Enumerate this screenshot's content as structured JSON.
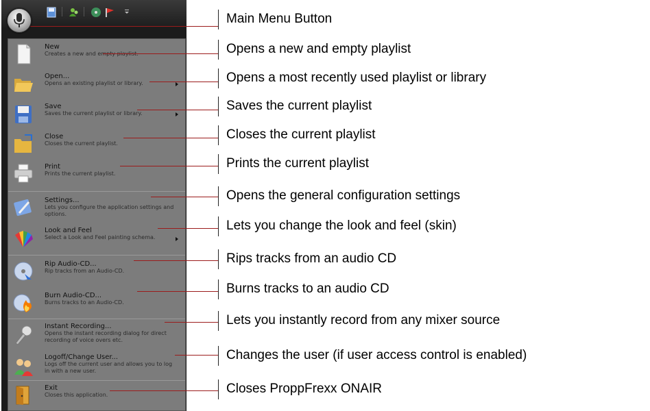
{
  "menu": {
    "items": [
      {
        "title": "New",
        "desc": "Creates a new and empty playlist.",
        "icon": "new-document-icon"
      },
      {
        "title": "Open...",
        "desc": "Opens an existing playlist or library.",
        "icon": "open-folder-icon"
      },
      {
        "title": "Save",
        "desc": "Saves the current playlist or library.",
        "icon": "save-floppy-icon"
      },
      {
        "title": "Close",
        "desc": "Closes the current playlist.",
        "icon": "close-folder-icon"
      },
      {
        "title": "Print",
        "desc": "Prints the current playlist.",
        "icon": "printer-icon"
      },
      {
        "title": "Settings...",
        "desc": "Lets you configure the application settings and options.",
        "icon": "settings-icon"
      },
      {
        "title": "Look and Feel",
        "desc": "Select a Look and Feel painting schema.",
        "icon": "palette-icon"
      },
      {
        "title": "Rip Audio-CD...",
        "desc": "Rip tracks from an Audio-CD.",
        "icon": "rip-cd-icon"
      },
      {
        "title": "Burn Audio-CD...",
        "desc": "Burns tracks to an Audio-CD.",
        "icon": "burn-cd-icon"
      },
      {
        "title": "Instant Recording...",
        "desc": "Opens the instant recording dialog for direct recording of voice overs etc.",
        "icon": "microphone-icon"
      },
      {
        "title": "Logoff/Change User...",
        "desc": "Logs off the current user and allows you to log in with a new user.",
        "icon": "users-icon"
      },
      {
        "title": "Exit",
        "desc": "Closes this application.",
        "icon": "exit-door-icon"
      }
    ]
  },
  "callouts": [
    "Main Menu Button",
    "Opens a new and empty playlist",
    "Opens a most recently used playlist or library",
    "Saves the current playlist",
    "Closes the current playlist",
    "Prints the current playlist",
    "Opens the general configuration settings",
    "Lets you change the look and feel (skin)",
    "Rips tracks from an audio CD",
    "Burns tracks to an audio CD",
    "Lets you instantly record from any mixer source",
    "Changes the user (if user access control is enabled)",
    "Closes ProppFrexx ONAIR"
  ],
  "colors": {
    "callout_line": "#9b1b1b",
    "menu_bg": "#7c7c7c",
    "frame": "#1b1b1b"
  }
}
